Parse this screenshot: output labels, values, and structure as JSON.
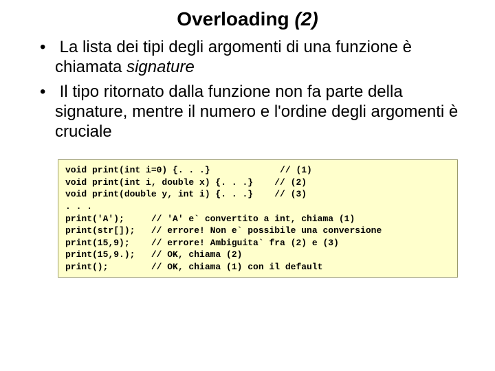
{
  "slide": {
    "title_main": "Overloading ",
    "title_ital": "(2)",
    "bullets": [
      {
        "pre": "La lista dei tipi degli argomenti di una funzione è chiamata ",
        "em": "signature",
        "post": ""
      },
      {
        "pre": "Il tipo ritornato dalla funzione non fa parte della signature, mentre il numero e l'ordine degli argomenti è cruciale",
        "em": "",
        "post": ""
      }
    ],
    "code": "void print(int i=0) {. . .}             // (1)\nvoid print(int i, double x) {. . .}    // (2)\nvoid print(double y, int i) {. . .}    // (3)\n. . .\nprint('A');     // 'A' e` convertito a int, chiama (1)\nprint(str[]);   // errore! Non e` possibile una conversione\nprint(15,9);    // errore! Ambiguita` fra (2) e (3)\nprint(15,9.);   // OK, chiama (2)\nprint();        // OK, chiama (1) con il default"
  }
}
